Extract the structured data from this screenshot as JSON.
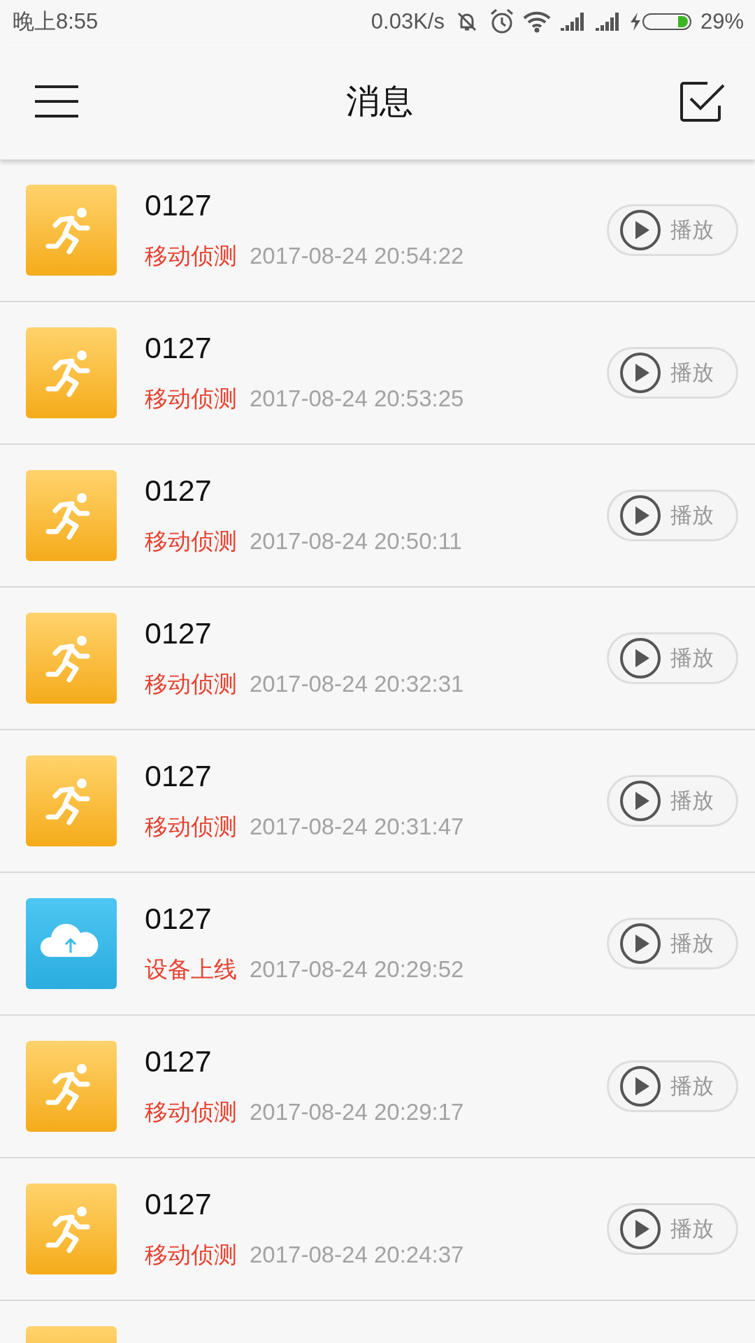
{
  "status_bar": {
    "time": "晚上8:55",
    "speed": "0.03K/s",
    "battery": "29%"
  },
  "header": {
    "title": "消息"
  },
  "messages": [
    {
      "kind": "motion",
      "device": "0127",
      "event": "移动侦测",
      "time": "2017-08-24 20:54:22",
      "action": "播放"
    },
    {
      "kind": "motion",
      "device": "0127",
      "event": "移动侦测",
      "time": "2017-08-24 20:53:25",
      "action": "播放"
    },
    {
      "kind": "motion",
      "device": "0127",
      "event": "移动侦测",
      "time": "2017-08-24 20:50:11",
      "action": "播放"
    },
    {
      "kind": "motion",
      "device": "0127",
      "event": "移动侦测",
      "time": "2017-08-24 20:32:31",
      "action": "播放"
    },
    {
      "kind": "motion",
      "device": "0127",
      "event": "移动侦测",
      "time": "2017-08-24 20:31:47",
      "action": "播放"
    },
    {
      "kind": "online",
      "device": "0127",
      "event": "设备上线",
      "time": "2017-08-24 20:29:52",
      "action": "播放"
    },
    {
      "kind": "motion",
      "device": "0127",
      "event": "移动侦测",
      "time": "2017-08-24 20:29:17",
      "action": "播放"
    },
    {
      "kind": "motion",
      "device": "0127",
      "event": "移动侦测",
      "time": "2017-08-24 20:24:37",
      "action": "播放"
    },
    {
      "kind": "motion"
    }
  ]
}
